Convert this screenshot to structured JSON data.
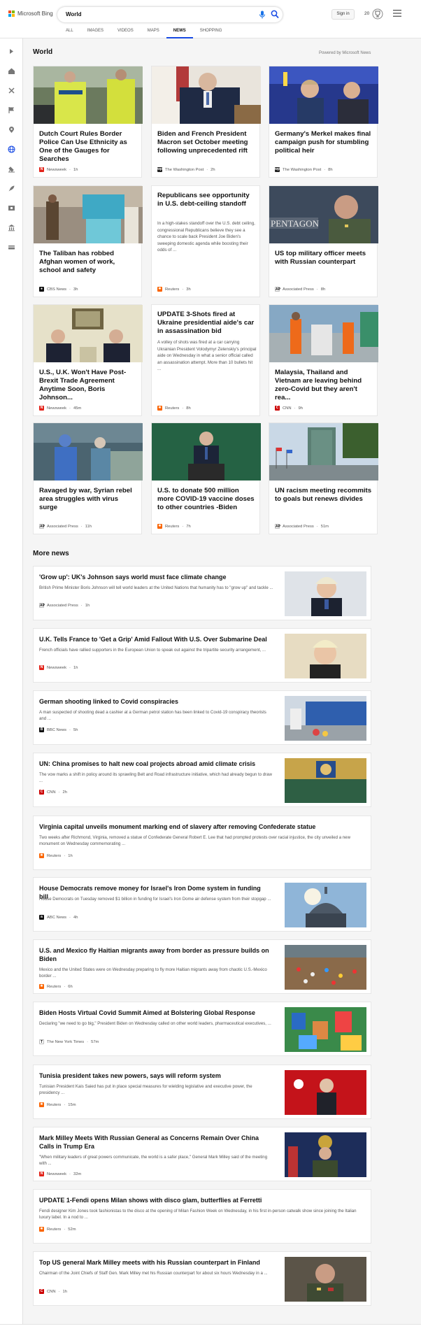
{
  "header": {
    "brand": "Microsoft Bing",
    "query": "World",
    "signin": "Sign in",
    "points": "20",
    "tabs": [
      "ALL",
      "IMAGES",
      "VIDEOS",
      "MAPS",
      "NEWS",
      "SHOPPING"
    ],
    "active_tab": "NEWS"
  },
  "rail_icons": [
    "expand-icon",
    "home-icon",
    "sports-icon",
    "flag-icon",
    "location-pin-icon",
    "globe-icon",
    "science-icon",
    "rocket-icon",
    "film-icon",
    "bank-icon",
    "money-icon"
  ],
  "section": {
    "title": "World",
    "powered": "Powered by Microsoft News"
  },
  "cards": [
    {
      "title": "Dutch Court Rules Border Police Can Use Ethnicity as One of the Gauges for Searches",
      "source": "Newsweek",
      "time": "1h"
    },
    {
      "title": "Biden and French President Macron set October meeting following unprecedented rift",
      "source": "The Washington Post",
      "time": "2h"
    },
    {
      "title": "Germany's Merkel makes final campaign push for stumbling political heir",
      "source": "The Washington Post",
      "time": "8h"
    },
    {
      "title": "The Taliban has robbed Afghan women of work, school and safety",
      "source": "CBS News",
      "time": "3h"
    },
    {
      "title": "Republicans see opportunity in U.S. debt-ceiling standoff",
      "desc": "In a high-stakes standoff over the U.S. debt ceiling, congressional Republicans believe they see a chance to scale back President Joe Biden's sweeping domestic agenda while boosting their odds of ...",
      "source": "Reuters",
      "time": "3h"
    },
    {
      "title": "US top military officer meets with Russian counterpart",
      "source": "Associated Press",
      "time": "8h"
    },
    {
      "title": "U.S., U.K. Won't Have Post-Brexit Trade Agreement Anytime Soon, Boris Johnson...",
      "source": "Newsweek",
      "time": "45m"
    },
    {
      "title": "UPDATE 3-Shots fired at Ukraine presidential aide's car in assassination bid",
      "desc": "A volley of shots was fired at a car carrying Ukrainian President Volodymyr Zelenskiy's principal aide on Wednesday in what a senior official called an assassination attempt. More than 10 bullets hit ...",
      "source": "Reuters",
      "time": "8h"
    },
    {
      "title": "Malaysia, Thailand and Vietnam are leaving behind zero-Covid but they aren't rea...",
      "source": "CNN",
      "time": "9h"
    },
    {
      "title": "Ravaged by war, Syrian rebel area struggles with virus surge",
      "source": "Associated Press",
      "time": "11h"
    },
    {
      "title": "U.S. to donate 500 million more COVID-19 vaccine doses to other countries -Biden",
      "source": "Reuters",
      "time": "7h"
    },
    {
      "title": "UN racism meeting recommits to goals but renews divides",
      "source": "Associated Press",
      "time": "51m"
    }
  ],
  "more": {
    "title": "More news"
  },
  "more_news": [
    {
      "title": "'Grow up': UK's Johnson says world must face climate change",
      "desc": "British Prime Minister Boris Johnson will tell world leaders at the United Nations that humanity has to \"grow up\" and tackle ...",
      "source": "Associated Press",
      "time": "1h"
    },
    {
      "title": "U.K. Tells France to 'Get a Grip' Amid Fallout With U.S. Over Submarine Deal",
      "desc": "French officials have rallied supporters in the European Union to speak out against the tripartite security arrangement, ...",
      "source": "Newsweek",
      "time": "1h"
    },
    {
      "title": "German shooting linked to Covid conspiracies",
      "desc": "A man suspected of shooting dead a cashier at a German petrol station has been linked to Covid-19 conspiracy theorists and ...",
      "source": "BBC News",
      "time": "5h"
    },
    {
      "title": "UN: China promises to halt new coal projects abroad amid climate crisis",
      "desc": "The vow marks a shift in policy around its sprawling Belt and Road infrastructure initiative, which had already begun to draw ...",
      "source": "CNN",
      "time": "2h"
    },
    {
      "title": "Virginia capital unveils monument marking end of slavery after removing Confederate statue",
      "desc": "Two weeks after Richmond, Virginia, removed a statue of Confederate General Robert E. Lee that had prompted protests over racial injustice, the city unveiled a new monument on Wednesday commemorating ...",
      "source": "Reuters",
      "time": "1h"
    },
    {
      "title": "House Democrats remove money for Israel's Iron Dome system in funding bill",
      "desc": "House Democrats on Tuesday removed $1 billion in funding for Israel's Iron Dome air defense system from their stopgap ...",
      "source": "ABC News",
      "time": "4h"
    },
    {
      "title": "U.S. and Mexico fly Haitian migrants away from border as pressure builds on Biden",
      "desc": "Mexico and the United States were on Wednesday preparing to fly more Haitian migrants away from chaotic U.S.-Mexico border ...",
      "source": "Reuters",
      "time": "6h"
    },
    {
      "title": "Biden Hosts Virtual Covid Summit Aimed at Bolstering Global Response",
      "desc": "Declaring \"we need to go big,\" President Biden on Wednesday called on other world leaders, pharmaceutical executives, ...",
      "source": "The New York Times",
      "time": "57m"
    },
    {
      "title": "Tunisia president takes new powers, says will reform system",
      "desc": "Tunisian President Kais Saied has put in place special measures for wielding legislative and executive power, the presidency ...",
      "source": "Reuters",
      "time": "15m"
    },
    {
      "title": "Mark Milley Meets With Russian General as Concerns Remain Over China Calls in Trump Era",
      "desc": "\"When military leaders of great powers communicate, the world is a safer place,\" General Mark Milley said of the meeting with ...",
      "source": "Newsweek",
      "time": "32m"
    },
    {
      "title": "UPDATE 1-Fendi opens Milan shows with disco glam, butterflies at Ferretti",
      "desc": "Fendi designer Kim Jones took fashionistas to the disco at the opening of Milan Fashion Week on Wednesday, in his first in-person catwalk show since joining the Italian luxury label. In a nod to ...",
      "source": "Reuters",
      "time": "52m"
    },
    {
      "title": "Top US general Mark Milley meets with his Russian counterpart in Finland",
      "desc": "Chairman of the Joint Chiefs of Staff Gen. Mark Milley met his Russian counterpart for about six hours Wednesday in a ...",
      "source": "CNN",
      "time": "1h"
    }
  ],
  "colors": {
    "accent": "#174ae4",
    "newsweek": "#e2231a",
    "reuters": "#fa6400",
    "cnn": "#cc0000"
  }
}
